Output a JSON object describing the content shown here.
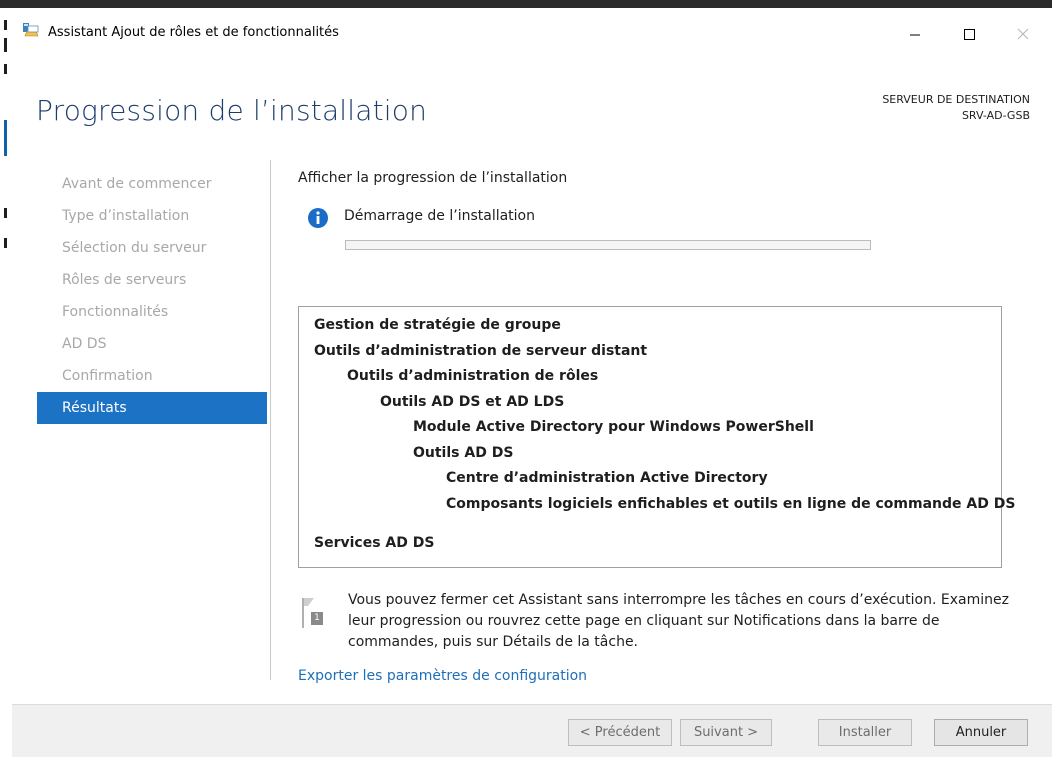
{
  "window": {
    "title": "Assistant Ajout de rôles et de fonctionnalités"
  },
  "header": {
    "page_title": "Progression de l’installation",
    "destination_label": "SERVEUR DE DESTINATION",
    "destination_server": "SRV-AD-GSB"
  },
  "sidebar": {
    "items": [
      {
        "label": "Avant de commencer"
      },
      {
        "label": "Type d’installation"
      },
      {
        "label": "Sélection du serveur"
      },
      {
        "label": "Rôles de serveurs"
      },
      {
        "label": "Fonctionnalités"
      },
      {
        "label": "AD DS"
      },
      {
        "label": "Confirmation"
      },
      {
        "label": "Résultats",
        "active": true
      }
    ]
  },
  "main": {
    "subtitle": "Afficher la progression de l’installation",
    "status": "Démarrage de l’installation",
    "progress": 0,
    "features": [
      {
        "text": "Gestion de stratégie de groupe",
        "level": 0
      },
      {
        "text": "Outils d’administration de serveur distant",
        "level": 0
      },
      {
        "text": "Outils d’administration de rôles",
        "level": 1
      },
      {
        "text": "Outils AD DS et AD LDS",
        "level": 2
      },
      {
        "text": "Module Active Directory pour Windows PowerShell",
        "level": 3
      },
      {
        "text": "Outils AD DS",
        "level": 3
      },
      {
        "text": "Centre d’administration Active Directory",
        "level": 4
      },
      {
        "text": "Composants logiciels enfichables et outils en ligne de commande AD DS",
        "level": 4
      },
      {
        "text": "Services AD DS",
        "level": 0
      }
    ],
    "note_badge": "1",
    "note": "Vous pouvez fermer cet Assistant sans interrompre les tâches en cours d’exécution. Examinez leur progression ou rouvrez cette page en cliquant sur Notifications dans la barre de commandes, puis sur Détails de la tâche.",
    "export_link": "Exporter les paramètres de configuration"
  },
  "footer": {
    "previous": "< Précédent",
    "next": "Suivant >",
    "install": "Installer",
    "cancel": "Annuler"
  },
  "colors": {
    "title_blue": "#1e3d6b",
    "active_nav": "#1c72c4",
    "link": "#1e6fb8",
    "info_icon": "#1a6cc7"
  },
  "icons": [
    "wizard-app-icon",
    "minimize-icon",
    "maximize-icon",
    "close-icon",
    "info-icon",
    "notification-flag-icon"
  ]
}
